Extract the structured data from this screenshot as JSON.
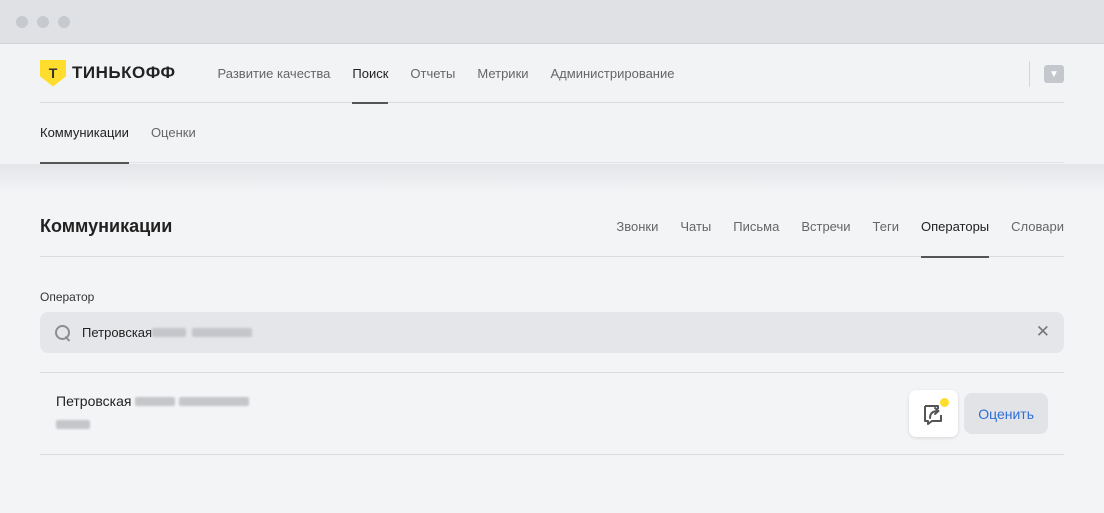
{
  "brand": {
    "logo_letter": "Т",
    "name": "ТИНЬКОФФ",
    "accent": "#ffdd2d"
  },
  "topnav": {
    "items": [
      {
        "label": "Развитие качества",
        "active": false
      },
      {
        "label": "Поиск",
        "active": true
      },
      {
        "label": "Отчеты",
        "active": false
      },
      {
        "label": "Метрики",
        "active": false
      },
      {
        "label": "Администрирование",
        "active": false
      }
    ],
    "right_icon": "mail-dropdown-icon"
  },
  "subnav": {
    "items": [
      {
        "label": "Коммуникации",
        "active": true
      },
      {
        "label": "Оценки",
        "active": false
      }
    ]
  },
  "page": {
    "title": "Коммуникации",
    "tabs": [
      {
        "label": "Звонки",
        "active": false
      },
      {
        "label": "Чаты",
        "active": false
      },
      {
        "label": "Письма",
        "active": false
      },
      {
        "label": "Встречи",
        "active": false
      },
      {
        "label": "Теги",
        "active": false
      },
      {
        "label": "Операторы",
        "active": true
      },
      {
        "label": "Словари",
        "active": false
      }
    ]
  },
  "filter": {
    "label": "Оператор",
    "search_value": "Петровская",
    "clear_icon": "close-icon"
  },
  "results": [
    {
      "name": "Петровская",
      "share_icon": "share-icon",
      "action_label": "Оценить",
      "action_color": "#2f6fd8"
    }
  ]
}
